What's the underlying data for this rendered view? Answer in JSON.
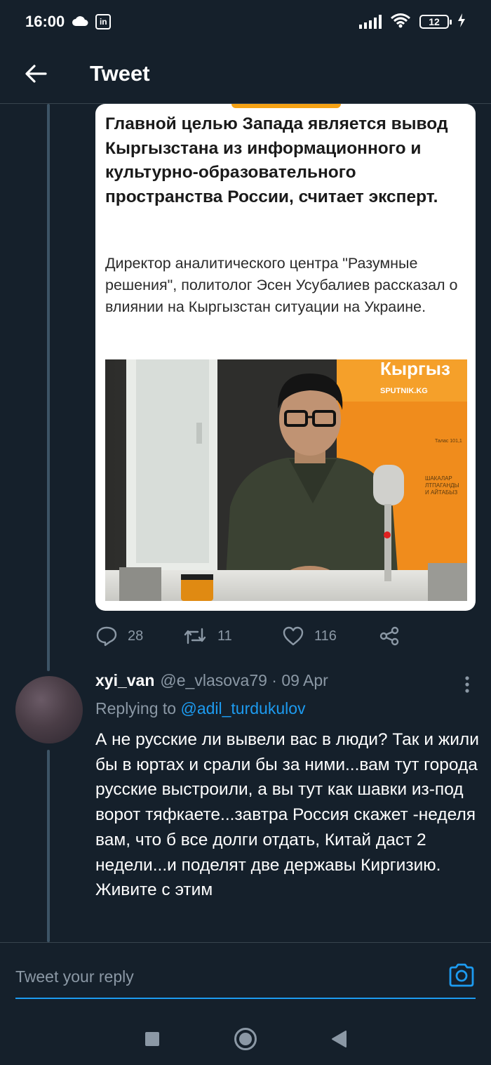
{
  "status_bar": {
    "time": "16:00",
    "linkedin_label": "in",
    "battery": "12"
  },
  "header": {
    "title": "Tweet"
  },
  "article_card": {
    "headline": "Главной целью Запада является вывод Кыргызстана из информационного и культурно-образовательного пространства России, считает эксперт.",
    "body": "Директор аналитического центра \"Разумные решения\", политолог Эсен Усубалиев рассказал о влиянии на Кыргызстан ситуации на Украине.",
    "photo_sign_text": "Кыргыз",
    "photo_sign_brand": "SPUTNIK.KG",
    "photo_sign_lines": [
      "ШАКАЛАР",
      "ЛТПАГАНДЫ",
      "И АЙТАБЫЗ"
    ],
    "photo_tag": "Талас 101,1"
  },
  "main_tweet_actions": {
    "replies": "28",
    "retweets": "11",
    "likes": "116"
  },
  "reply": {
    "name": "xyi_van",
    "handle_date": "@e_vlasova79 · 09 Apr",
    "replying_prefix": "Replying to ",
    "replying_to": "@adil_turdukulov",
    "text": "А не русские ли вывели вас в люди? Так и жили бы в юртах и срали бы за ними...вам тут города русские выстроили, а вы тут как шавки из-под ворот тяфкаете...завтра Россия скажет -неделя вам, что б все долги отдать, Китай даст 2 недели...и поделят две державы Киргизию. Живите с этим"
  },
  "composer": {
    "placeholder": "Tweet your reply"
  },
  "colors": {
    "background": "#15202b",
    "accent": "#1d9bf0",
    "muted": "#8b98a5",
    "orange": "#f6a214"
  }
}
